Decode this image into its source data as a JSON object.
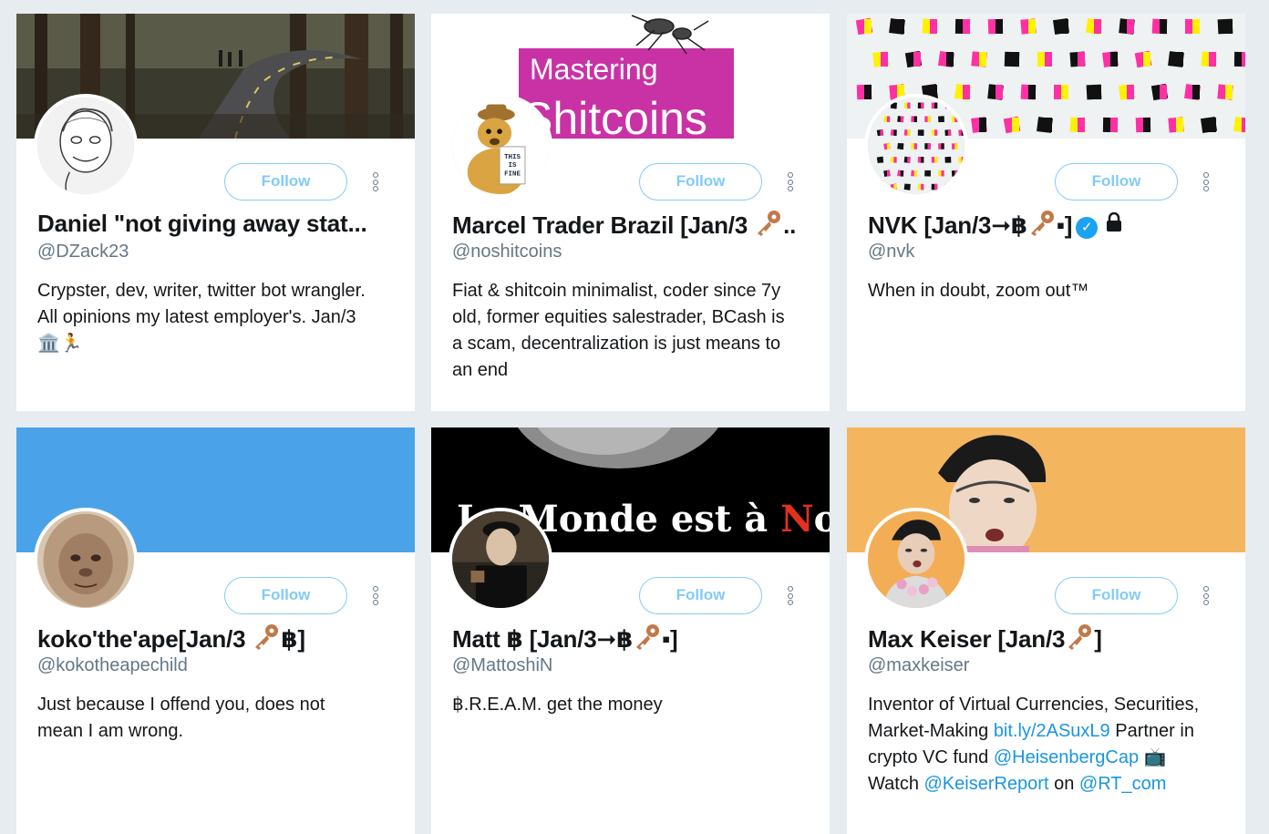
{
  "follow_label": "Follow",
  "cards": [
    {
      "name": "Daniel \"not giving away stat...",
      "handle": "@DZack23",
      "bio_lines": [
        "Crypster, dev, writer, twitter bot wrangler.",
        "All opinions my latest employer's. Jan/3",
        "🏛️🏃"
      ]
    },
    {
      "name_prefix": "Marcel Trader Brazil [Jan/3",
      "name_suffix": "..",
      "handle": "@noshitcoins",
      "banner_text_1": "Mastering",
      "banner_text_2": "Shitcoins",
      "avatar_sign": "THIS IS FINE",
      "bio_lines": [
        "Fiat & shitcoin minimalist, coder since 7y",
        "old, former equities salestrader, BCash is",
        "a scam, decentralization is just means to",
        "an end"
      ]
    },
    {
      "name_prefix": "NVK [Jan/3➞฿",
      "name_suffix": "▪]",
      "handle": "@nvk",
      "verified_glyph": "✓",
      "bio_lines": [
        "When in doubt, zoom out™"
      ]
    },
    {
      "name_prefix": "koko'the'ape[Jan/3 ",
      "name_suffix": "฿]",
      "handle": "@kokotheapechild",
      "bio_lines": [
        "Just because I offend you, does not",
        "mean I am wrong."
      ]
    },
    {
      "name_prefix": "Matt ฿ [Jan/3➞฿",
      "name_suffix": "▪]",
      "handle": "@MattoshiN",
      "banner_text_pre": "Le Monde est à ",
      "banner_text_n": "N",
      "banner_text_post": "ous",
      "bio_lines": [
        "฿.R.E.A.M. get the money"
      ]
    },
    {
      "name_prefix": "Max Keiser [Jan/3",
      "name_suffix": "]",
      "handle": "@maxkeiser",
      "bio": {
        "l1": "Inventor of Virtual Currencies, Securities,",
        "l2_pre": "Market-Making ",
        "l2_link": "bit.ly/2ASuxL9",
        "l2_post": " Partner in",
        "l3_pre": "crypto VC fund ",
        "l3_link": "@HeisenbergCap",
        "l3_post": " 📺",
        "l4_pre": "Watch ",
        "l4_link1": "@KeiserReport",
        "l4_mid": " on ",
        "l4_link2": "@RT_com"
      }
    }
  ],
  "colors": {
    "accent": "#1da1f2",
    "link": "#1b95e0",
    "banner_blue": "#4aa3e8",
    "banner_orange": "#f4b55f",
    "banner_magenta": "#c932a5"
  }
}
